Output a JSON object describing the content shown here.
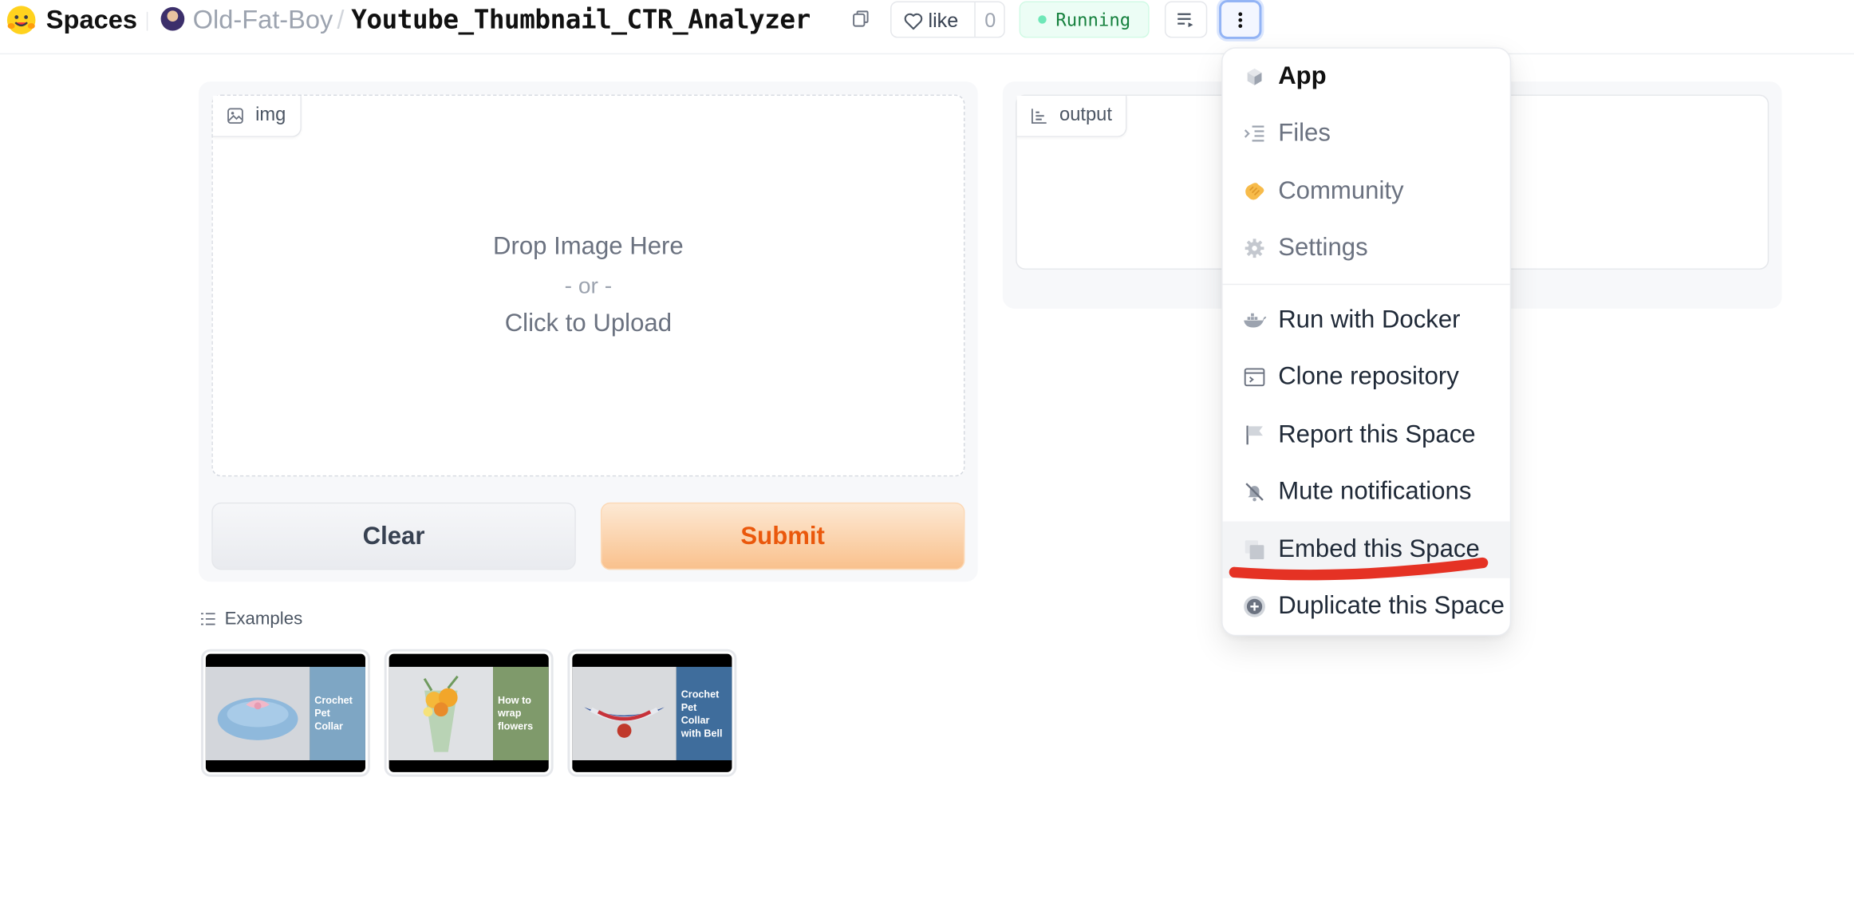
{
  "header": {
    "brand": "Spaces",
    "owner": "Old-Fat-Boy",
    "separator": "/",
    "repo": "Youtube_Thumbnail_CTR_Analyzer",
    "like_label": "like",
    "like_count": "0",
    "status": "Running"
  },
  "input": {
    "tag_label": "img",
    "drop_line1": "Drop Image Here",
    "drop_line2": "- or -",
    "drop_line3": "Click to Upload",
    "clear_label": "Clear",
    "submit_label": "Submit"
  },
  "output": {
    "tag_label": "output"
  },
  "examples": {
    "label": "Examples",
    "items": [
      {
        "text": "Crochet\nPet\nCollar",
        "side_color": "#7ea6c4",
        "photo_bg": "#c9cdd3"
      },
      {
        "text": "How to\nwrap\nflowers",
        "side_color": "#7f9a6b",
        "photo_bg": "#d6d8db"
      },
      {
        "text": "Crochet\nPet\nCollar\nwith Bell",
        "side_color": "#3f6d9c",
        "photo_bg": "#d0d3d7"
      }
    ]
  },
  "menu": {
    "items": [
      {
        "label": "App",
        "icon": "cube-icon"
      },
      {
        "label": "Files",
        "icon": "files-icon"
      },
      {
        "label": "Community",
        "icon": "community-icon"
      },
      {
        "label": "Settings",
        "icon": "gear-icon"
      },
      {
        "label": "Run with Docker",
        "icon": "docker-icon"
      },
      {
        "label": "Clone repository",
        "icon": "terminal-icon"
      },
      {
        "label": "Report this Space",
        "icon": "flag-icon"
      },
      {
        "label": "Mute notifications",
        "icon": "mute-icon"
      },
      {
        "label": "Embed this Space",
        "icon": "embed-icon"
      },
      {
        "label": "Duplicate this Space",
        "icon": "duplicate-icon"
      }
    ]
  },
  "colors": {
    "accent_orange": "#ea580c",
    "running_green": "#15803d",
    "annotation_red": "#e53224"
  }
}
